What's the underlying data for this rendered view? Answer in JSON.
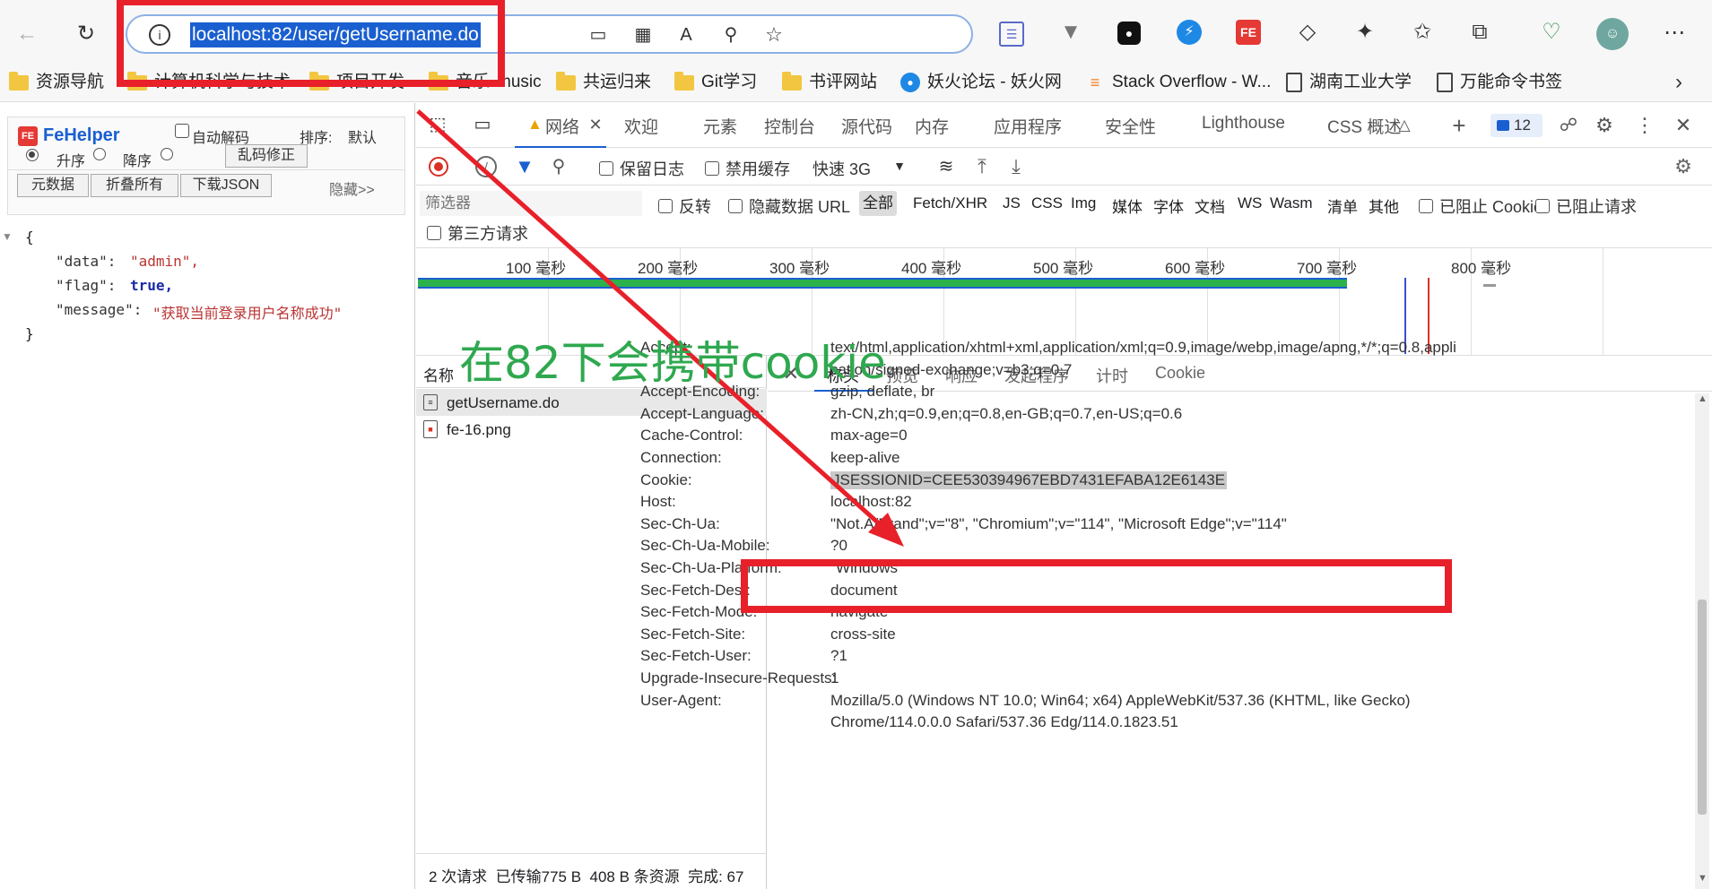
{
  "browser": {
    "url": "localhost:82/user/getUsername.do",
    "bookmarks": [
      "资源导航",
      "计算机科学与技术",
      "项目开发",
      "音乐",
      "music",
      "共运归来",
      "Git学习",
      "书评网站",
      "妖火论坛 - 妖火网",
      "Stack Overflow - W...",
      "湖南工业大学",
      "万能命令书签"
    ]
  },
  "fehelper": {
    "title": "FeHelper",
    "auto_decode": "自动解码",
    "sort_label": "排序:",
    "sort_value": "默认",
    "asc": "升序",
    "desc": "降序",
    "fix_button": "乱码修正",
    "buttons": [
      "元数据",
      "折叠所有",
      "下载JSON"
    ],
    "hide": "隐藏>>",
    "json": {
      "data_key": "\"data\":",
      "data_val": "\"admin\",",
      "flag_key": "\"flag\":",
      "flag_val": "true,",
      "message_key": "\"message\":",
      "message_val": "\"获取当前登录用户名称成功\""
    }
  },
  "devtools": {
    "tabs": [
      "网络",
      "欢迎",
      "元素",
      "控制台",
      "源代码",
      "内存",
      "应用程序",
      "安全性",
      "Lighthouse",
      "CSS 概述"
    ],
    "issue_count": "12",
    "preserve_log": "保留日志",
    "disable_cache": "禁用缓存",
    "throttle": "快速 3G",
    "filter_placeholder": "筛选器",
    "invert": "反转",
    "hide_data_url": "隐藏数据 URL",
    "types": [
      "全部",
      "Fetch/XHR",
      "JS",
      "CSS",
      "Img",
      "媒体",
      "字体",
      "文档",
      "WS",
      "Wasm",
      "清单",
      "其他"
    ],
    "blocked_cookie": "已阻止 Cookie",
    "blocked_requests": "已阻止请求",
    "third_party": "第三方请求",
    "timeline": [
      "100 毫秒",
      "200 毫秒",
      "300 毫秒",
      "400 毫秒",
      "500 毫秒",
      "600 毫秒",
      "700 毫秒",
      "800 毫秒"
    ],
    "name_col": "名称",
    "requests": [
      "getUsername.do",
      "fe-16.png"
    ],
    "status_bar": "2 次请求  已传输775 B  408 B 条资源  完成: 67",
    "detail_tabs": [
      "标头",
      "预览",
      "响应",
      "发起程序",
      "计时",
      "Cookie"
    ],
    "headers": [
      {
        "k": "Accept:",
        "v": "text/html,application/xhtml+xml,application/xml;q=0.9,image/webp,image/apng,*/*;q=0.8,appli"
      },
      {
        "k": "",
        "v": "cation/signed-exchange;v=b3;q=0.7"
      },
      {
        "k": "Accept-Encoding:",
        "v": "gzip, deflate, br"
      },
      {
        "k": "Accept-Language:",
        "v": "zh-CN,zh;q=0.9,en;q=0.8,en-GB;q=0.7,en-US;q=0.6"
      },
      {
        "k": "Cache-Control:",
        "v": "max-age=0"
      },
      {
        "k": "Connection:",
        "v": "keep-alive"
      },
      {
        "k": "Cookie:",
        "v": "JSESSIONID=CEE530394967EBD7431EFABA12E6143E"
      },
      {
        "k": "Host:",
        "v": "localhost:82"
      },
      {
        "k": "Sec-Ch-Ua:",
        "v": "\"Not.A/Brand\";v=\"8\", \"Chromium\";v=\"114\", \"Microsoft Edge\";v=\"114\""
      },
      {
        "k": "Sec-Ch-Ua-Mobile:",
        "v": "?0"
      },
      {
        "k": "Sec-Ch-Ua-Platform:",
        "v": "\"Windows\""
      },
      {
        "k": "Sec-Fetch-Dest:",
        "v": "document"
      },
      {
        "k": "Sec-Fetch-Mode:",
        "v": "navigate"
      },
      {
        "k": "Sec-Fetch-Site:",
        "v": "cross-site"
      },
      {
        "k": "Sec-Fetch-User:",
        "v": "?1"
      },
      {
        "k": "Upgrade-Insecure-Requests:",
        "v": "1"
      },
      {
        "k": "User-Agent:",
        "v": "Mozilla/5.0 (Windows NT 10.0; Win64; x64) AppleWebKit/537.36 (KHTML, like Gecko)"
      },
      {
        "k": "",
        "v": "Chrome/114.0.0.0 Safari/537.36 Edg/114.0.1823.51"
      }
    ]
  },
  "annotation": {
    "text": "在82下会携带cookie",
    "color": "#2fa84f",
    "highlight_color": "#e8202a"
  }
}
